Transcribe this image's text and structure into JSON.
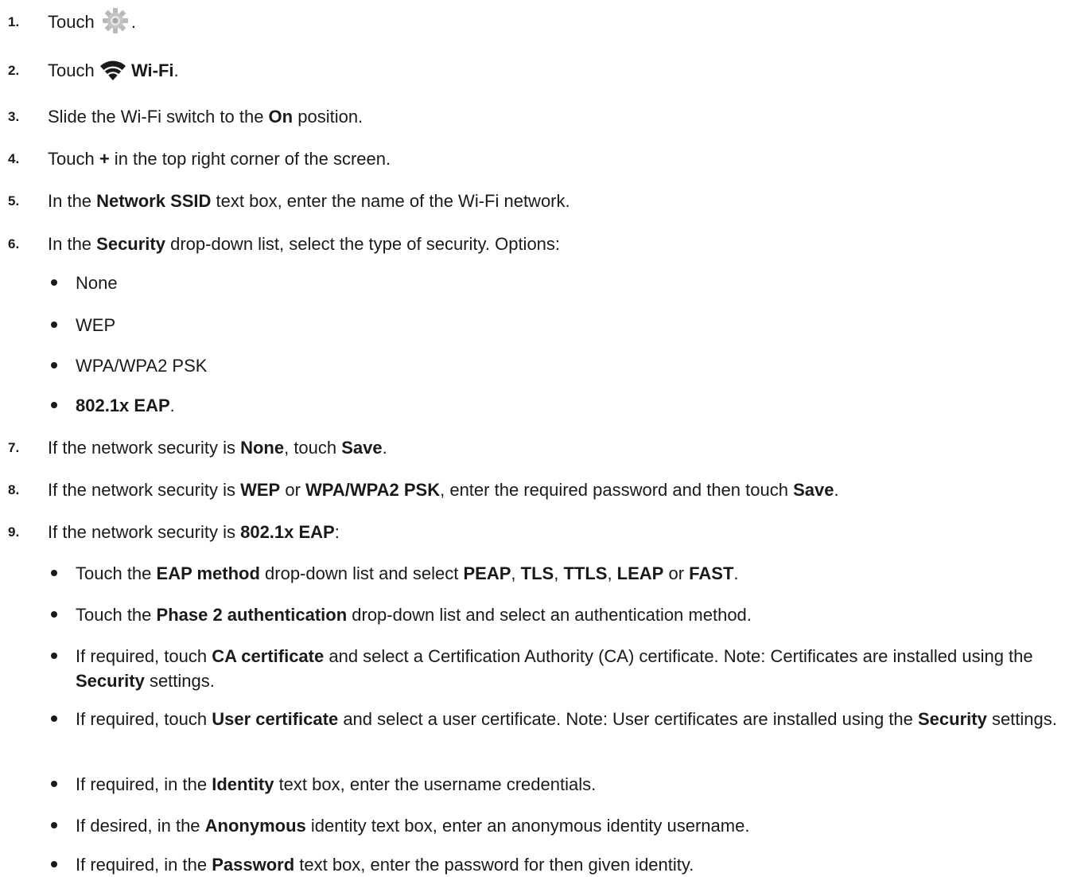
{
  "steps": [
    {
      "num": "1.",
      "t": [
        "Touch ",
        ""
      ],
      "end": "."
    },
    {
      "num": "2.",
      "t": [
        "Touch ",
        "Wi-Fi",
        "."
      ]
    },
    {
      "num": "3.",
      "t": [
        "Slide the Wi-Fi switch to the ",
        "On",
        " position."
      ]
    },
    {
      "num": "4.",
      "t": [
        "Touch ",
        "+",
        " in the top right corner of the screen."
      ]
    },
    {
      "num": "5.",
      "t": [
        "In the ",
        "Network SSID",
        " text box, enter the name of the Wi-Fi network."
      ]
    },
    {
      "num": "6.",
      "t": [
        "In the ",
        "Security",
        " drop-down list, select the type of security. Options:"
      ]
    },
    {
      "num": "7.",
      "t": [
        "If the network security is ",
        "None",
        ", touch ",
        "Save",
        "."
      ]
    },
    {
      "num": "8.",
      "t": [
        "If the network security is ",
        "WEP",
        " or ",
        "WPA/WPA2 PSK",
        ", enter the required password and then touch ",
        "Save",
        "."
      ]
    },
    {
      "num": "9.",
      "t": [
        "If the network security is ",
        "802.1x EAP",
        ":"
      ]
    }
  ],
  "security_options": [
    "None",
    "WEP",
    "WPA/WPA2 PSK",
    "802.1x EAP",
    "."
  ],
  "eap_bullets": {
    "b1": [
      "Touch the ",
      "EAP method",
      " drop-down list and select ",
      "PEAP",
      ", ",
      "TLS",
      ", ",
      "TTLS",
      ", ",
      "LEAP",
      " or ",
      "FAST",
      "."
    ],
    "b2": [
      "Touch the ",
      "Phase 2 authentication",
      " drop-down list and select an authentication method."
    ],
    "b3": [
      "If required, touch ",
      "CA certificate",
      " and select a Certification Authority (CA) certificate. Note: Certificates are installed using the ",
      "Security",
      " settings."
    ],
    "b4": [
      "If required, touch ",
      "User certificate",
      " and select a user certificate. Note: User certificates are installed using the ",
      "Security",
      " settings."
    ],
    "b5": [
      "If required, in the ",
      "Identity",
      " text box, enter the username credentials."
    ],
    "b6": [
      "If desired, in the ",
      "Anonymous",
      " identity text box, enter an anonymous identity username."
    ],
    "b7": [
      "If required, in the ",
      "Password",
      " text box, enter the password for then given identity."
    ]
  },
  "icons": {
    "settings": "gear-icon",
    "wifi": "wifi-icon"
  }
}
